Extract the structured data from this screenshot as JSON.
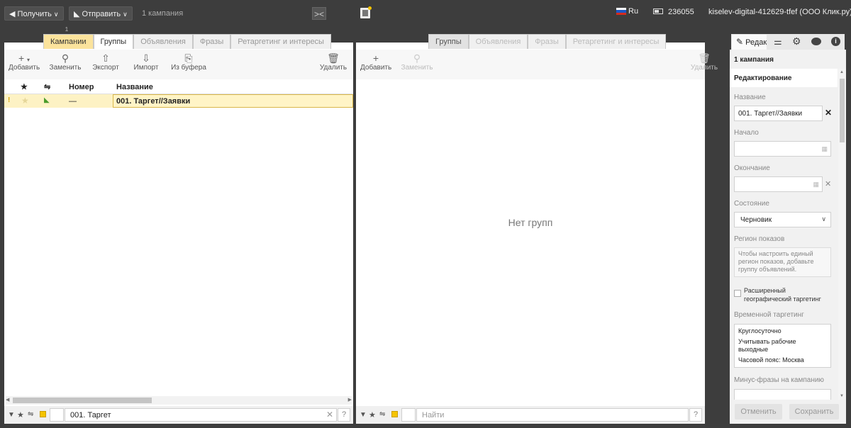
{
  "topbar": {
    "get_button": "Получить",
    "send_button": "Отправить",
    "campaign_count": "1 кампания",
    "language": "Ru",
    "balance": "236055",
    "account": "kiselev-digital-412629-tfef (ООО Клик.ру)",
    "badge_count": "1"
  },
  "left_panel": {
    "tabs": [
      "Кампании",
      "Группы",
      "Объявления",
      "Фразы",
      "Ретаргетинг и интересы"
    ],
    "toolbar": {
      "add": "Добавить",
      "replace": "Заменить",
      "export": "Экспорт",
      "import": "Импорт",
      "from_buffer": "Из буфера",
      "delete": "Удалить"
    },
    "table": {
      "col_number": "Номер",
      "col_name": "Название",
      "rows": [
        {
          "mark": "!",
          "number": "—",
          "name": "001. Таргет//Заявки"
        }
      ]
    },
    "filter_value": "001. Таргет",
    "help": "?"
  },
  "middle_panel": {
    "tabs": [
      "Группы",
      "Объявления",
      "Фразы",
      "Ретаргетинг и интересы"
    ],
    "toolbar": {
      "add": "Добавить",
      "replace": "Заменить",
      "delete": "Удалить"
    },
    "empty_text": "Нет групп",
    "search_placeholder": "Найти",
    "help": "?"
  },
  "right_panel": {
    "tab_edit": "Редактирование",
    "campaign_count": "1 кампания",
    "section_title": "Редактирование",
    "name_label": "Название",
    "name_value": "001. Таргет//Заявки",
    "start_label": "Начало",
    "end_label": "Окончание",
    "state_label": "Состояние",
    "state_value": "Черновик",
    "region_label": "Регион показов",
    "region_hint": "Чтобы настроить единый регион показов, добавьте группу объявлений.",
    "geo_checkbox_label": "Расширенный географический таргетинг",
    "time_label": "Временной таргетинг",
    "time_lines": [
      "Круглосуточно",
      "Учитывать рабочие выходные",
      "Часовой пояс: Москва"
    ],
    "minus_label": "Минус-фразы на кампанию",
    "cancel_button": "Отменить",
    "save_button": "Сохранить"
  }
}
